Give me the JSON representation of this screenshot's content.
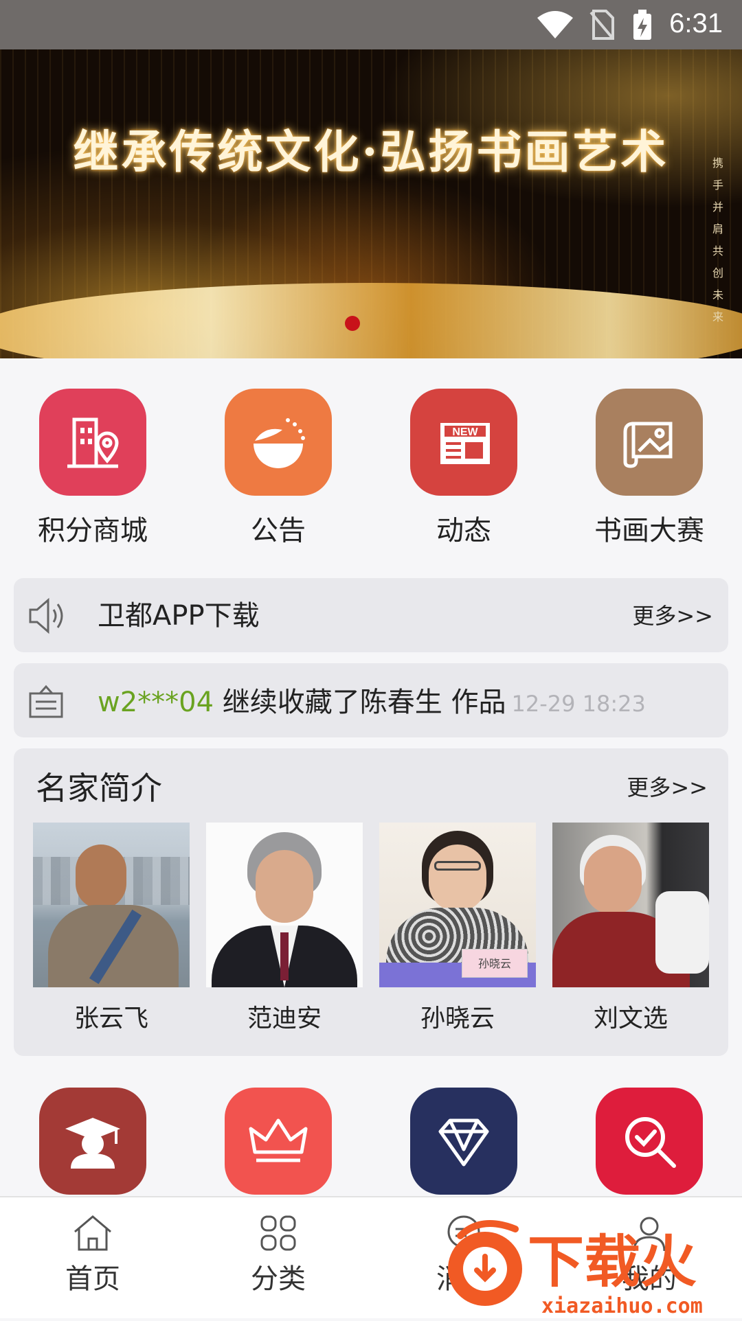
{
  "status_bar": {
    "time": "6:31",
    "icons": [
      "wifi-icon",
      "no-sim-icon",
      "battery-charging-icon"
    ]
  },
  "banner": {
    "headline": "继承传统文化·弘扬书画艺术",
    "side_text": "携手并肩共创未来"
  },
  "top_menu": [
    {
      "label": "积分商城",
      "icon": "building-location-icon",
      "color": "#e0405a"
    },
    {
      "label": "公告",
      "icon": "leaf-icon",
      "color": "#ee7a42"
    },
    {
      "label": "动态",
      "icon": "newspaper-icon",
      "color": "#d5433f"
    },
    {
      "label": "书画大赛",
      "icon": "scroll-icon",
      "color": "#a9805f"
    }
  ],
  "notice": {
    "text": "卫都APP下载",
    "more": "更多>>"
  },
  "ticker": {
    "user": "w2***04",
    "message": " 继续收藏了陈春生 作品",
    "time": "12-29 18:23"
  },
  "famous": {
    "title": "名家简介",
    "more": "更多>>",
    "artists": [
      {
        "name": "张云飞"
      },
      {
        "name": "范迪安"
      },
      {
        "name": "孙晓云",
        "sign": "孙晓云"
      },
      {
        "name": "刘文选"
      }
    ]
  },
  "bottom_menu": [
    {
      "icon": "graduate-icon",
      "color": "#a33a36"
    },
    {
      "icon": "crown-icon",
      "color": "#f2534f"
    },
    {
      "icon": "diamond-icon",
      "color": "#27305f"
    },
    {
      "icon": "search-check-icon",
      "color": "#de1d3c"
    }
  ],
  "tabbar": [
    {
      "label": "首页",
      "icon": "home-icon"
    },
    {
      "label": "分类",
      "icon": "category-icon"
    },
    {
      "label": "消息",
      "icon": "message-icon"
    },
    {
      "label": "我的",
      "icon": "user-icon"
    }
  ],
  "watermark": {
    "brand": "下载火",
    "url": "xiazaihuo.com"
  }
}
